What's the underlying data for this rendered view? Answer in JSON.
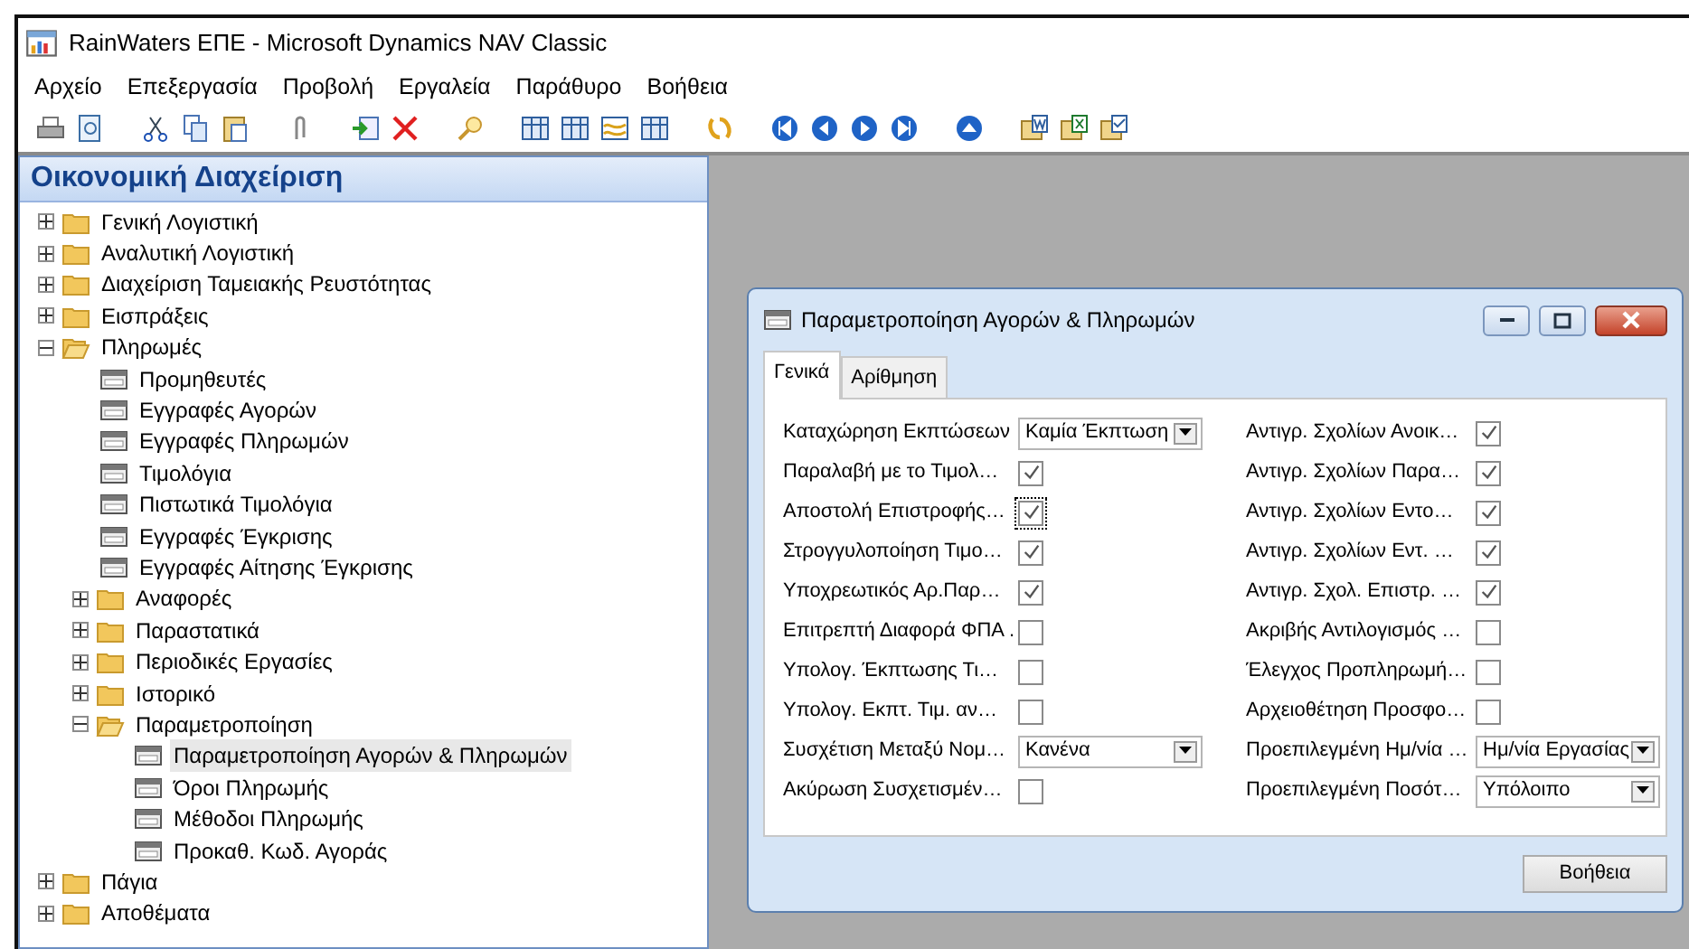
{
  "window": {
    "title": "RainWaters ΕΠΕ - Microsoft Dynamics NAV Classic"
  },
  "menu": [
    "Αρχείο",
    "Επεξεργασία",
    "Προβολή",
    "Εργαλεία",
    "Παράθυρο",
    "Βοήθεια"
  ],
  "navigation_pane": {
    "title": "Οικονομική Διαχείριση",
    "tree": [
      {
        "label": "Γενική Λογιστική",
        "kind": "folder",
        "expanded": false,
        "selected": false
      },
      {
        "label": "Αναλυτική Λογιστική",
        "kind": "folder",
        "expanded": false,
        "selected": false
      },
      {
        "label": "Διαχείριση Ταμειακής Ρευστότητας",
        "kind": "folder",
        "expanded": false,
        "selected": false
      },
      {
        "label": "Εισπράξεις",
        "kind": "folder",
        "expanded": false,
        "selected": false
      },
      {
        "label": "Πληρωμές",
        "kind": "folder",
        "expanded": true,
        "selected": false,
        "children": [
          {
            "label": "Προμηθευτές",
            "kind": "form",
            "selected": false
          },
          {
            "label": "Εγγραφές Αγορών",
            "kind": "form",
            "selected": false
          },
          {
            "label": "Εγγραφές Πληρωμών",
            "kind": "form",
            "selected": false
          },
          {
            "label": "Τιμολόγια",
            "kind": "form",
            "selected": false
          },
          {
            "label": "Πιστωτικά Τιμολόγια",
            "kind": "form",
            "selected": false
          },
          {
            "label": "Εγγραφές Έγκρισης",
            "kind": "form",
            "selected": false
          },
          {
            "label": "Εγγραφές Αίτησης Έγκρισης",
            "kind": "form",
            "selected": false
          },
          {
            "label": "Αναφορές",
            "kind": "folder",
            "expanded": false,
            "selected": false
          },
          {
            "label": "Παραστατικά",
            "kind": "folder",
            "expanded": false,
            "selected": false
          },
          {
            "label": "Περιοδικές Εργασίες",
            "kind": "folder",
            "expanded": false,
            "selected": false
          },
          {
            "label": "Ιστορικό",
            "kind": "folder",
            "expanded": false,
            "selected": false
          },
          {
            "label": "Παραμετροποίηση",
            "kind": "folder",
            "expanded": true,
            "selected": false,
            "children": [
              {
                "label": "Παραμετροποίηση Αγορών & Πληρωμών",
                "kind": "form",
                "selected": true
              },
              {
                "label": "Όροι Πληρωμής",
                "kind": "form",
                "selected": false
              },
              {
                "label": "Μέθοδοι Πληρωμής",
                "kind": "form",
                "selected": false
              },
              {
                "label": "Προκαθ. Κωδ. Αγοράς",
                "kind": "form",
                "selected": false
              }
            ]
          }
        ]
      },
      {
        "label": "Πάγια",
        "kind": "folder",
        "expanded": false,
        "selected": false
      },
      {
        "label": "Αποθέματα",
        "kind": "folder",
        "expanded": false,
        "selected": false
      }
    ]
  },
  "dialog": {
    "title": "Παραμετροποίηση Αγορών & Πληρωμών",
    "tabs": [
      {
        "label": "Γενικά",
        "selected": true
      },
      {
        "label": "Αρίθμηση",
        "selected": false
      }
    ],
    "left_fields": [
      {
        "label": "Καταχώρηση Εκπτώσεων",
        "kind": "combo",
        "value": "Καμία Έκπτωση"
      },
      {
        "label": "Παραλαβή με το Τιμολ…",
        "kind": "checkbox",
        "checked": true,
        "focused": false
      },
      {
        "label": "Αποστολή Επιστροφής…",
        "kind": "checkbox",
        "checked": true,
        "focused": true
      },
      {
        "label": "Στρογγυλοποίηση Τιμο…",
        "kind": "checkbox",
        "checked": true,
        "focused": false
      },
      {
        "label": "Υποχρεωτικός Αρ.Παρ…",
        "kind": "checkbox",
        "checked": true,
        "focused": false
      },
      {
        "label": "Επιτρεπτή Διαφορά ΦΠΑ .",
        "kind": "checkbox",
        "checked": false,
        "focused": false
      },
      {
        "label": "Υπολογ. Έκπτωσης Τι…",
        "kind": "checkbox",
        "checked": false,
        "focused": false
      },
      {
        "label": "Υπολογ. Εκπτ. Τιμ. αν…",
        "kind": "checkbox",
        "checked": false,
        "focused": false
      },
      {
        "label": "Συσχέτιση Μεταξύ Νομ…",
        "kind": "combo",
        "value": "Κανένα"
      },
      {
        "label": "Ακύρωση Συσχετισμέν…",
        "kind": "checkbox",
        "checked": false,
        "focused": false
      }
    ],
    "right_fields": [
      {
        "label": "Αντιγρ. Σχολίων Ανοικ…",
        "kind": "checkbox",
        "checked": true,
        "focused": false
      },
      {
        "label": "Αντιγρ. Σχολίων Παρα…",
        "kind": "checkbox",
        "checked": true,
        "focused": false
      },
      {
        "label": "Αντιγρ. Σχολίων Εντο…",
        "kind": "checkbox",
        "checked": true,
        "focused": false
      },
      {
        "label": "Αντιγρ. Σχολίων Εντ. …",
        "kind": "checkbox",
        "checked": true,
        "focused": false
      },
      {
        "label": "Αντιγρ. Σχολ. Επιστρ. …",
        "kind": "checkbox",
        "checked": true,
        "focused": false
      },
      {
        "label": "Ακριβής Αντιλογισμός …",
        "kind": "checkbox",
        "checked": false,
        "focused": false
      },
      {
        "label": "Έλεγχος Προπληρωμή…",
        "kind": "checkbox",
        "checked": false,
        "focused": false
      },
      {
        "label": "Αρχειοθέτηση Προσφο…",
        "kind": "checkbox",
        "checked": false,
        "focused": false
      },
      {
        "label": "Προεπιλεγμένη Ημ/νία …",
        "kind": "combo",
        "value": "Ημ/νία Εργασίας"
      },
      {
        "label": "Προεπιλεγμένη Ποσότ…",
        "kind": "combo",
        "value": "Υπόλοιπο"
      }
    ],
    "buttons": [
      "Βοήθεια"
    ]
  }
}
